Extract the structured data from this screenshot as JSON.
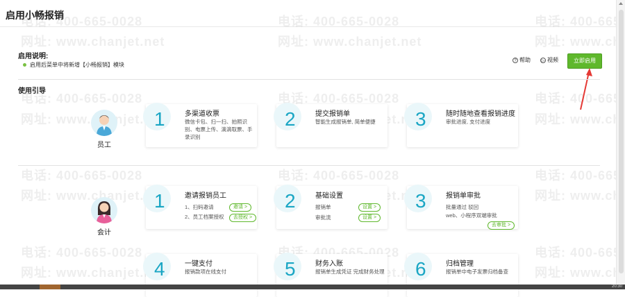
{
  "page_title": "启用小畅报销",
  "watermark": {
    "phone": "电话: 400-665-0028",
    "site": "网址: www.chanjet.net"
  },
  "intro": {
    "heading": "启用说明:",
    "bullet": "启用后菜单中将新增【小畅报销】模块"
  },
  "toolbar": {
    "help_icon": "?",
    "help_label": "帮助",
    "video_icon": "▷",
    "video_label": "视频",
    "enable_label": "立即启用",
    "accent_color": "#5fb82c"
  },
  "guide": {
    "heading": "使用引导",
    "roles": [
      {
        "name": "员工",
        "steps": [
          {
            "num": "1",
            "title": "多渠道收票",
            "desc": "微信卡包、扫一扫、拍照识别、电票上传、滴滴取票、手录识别"
          },
          {
            "num": "2",
            "title": "提交报销单",
            "desc": "智能生成报销单, 简单便捷"
          },
          {
            "num": "3",
            "title": "随时随地查看报销进度",
            "desc": "审批进度, 支付进度"
          }
        ]
      },
      {
        "name": "会计",
        "steps": [
          {
            "num": "1",
            "title": "邀请报销员工",
            "line1": "1、扫码邀请",
            "line2": "2、员工档案授权",
            "btn1": "邀请 >",
            "btn2": "去授权 >"
          },
          {
            "num": "2",
            "title": "基础设置",
            "line1": "报销单",
            "line2": "审批流",
            "btn1": "设置 >",
            "btn2": "设置 >"
          },
          {
            "num": "3",
            "title": "报销单审批",
            "line1": "批量通过 驳回",
            "line2": "web、小程序双端审批",
            "btn1": "去审批 >"
          }
        ]
      },
      {
        "name": "",
        "steps": [
          {
            "num": "4",
            "title": "一键支付",
            "desc": "报销款项在线支付"
          },
          {
            "num": "5",
            "title": "财务入账",
            "desc": "报销单生成凭证 完成财务处理"
          },
          {
            "num": "6",
            "title": "归档管理",
            "desc": "报销单中电子发票归档备查"
          }
        ]
      }
    ]
  },
  "taskbar": {
    "time": "20:30"
  }
}
